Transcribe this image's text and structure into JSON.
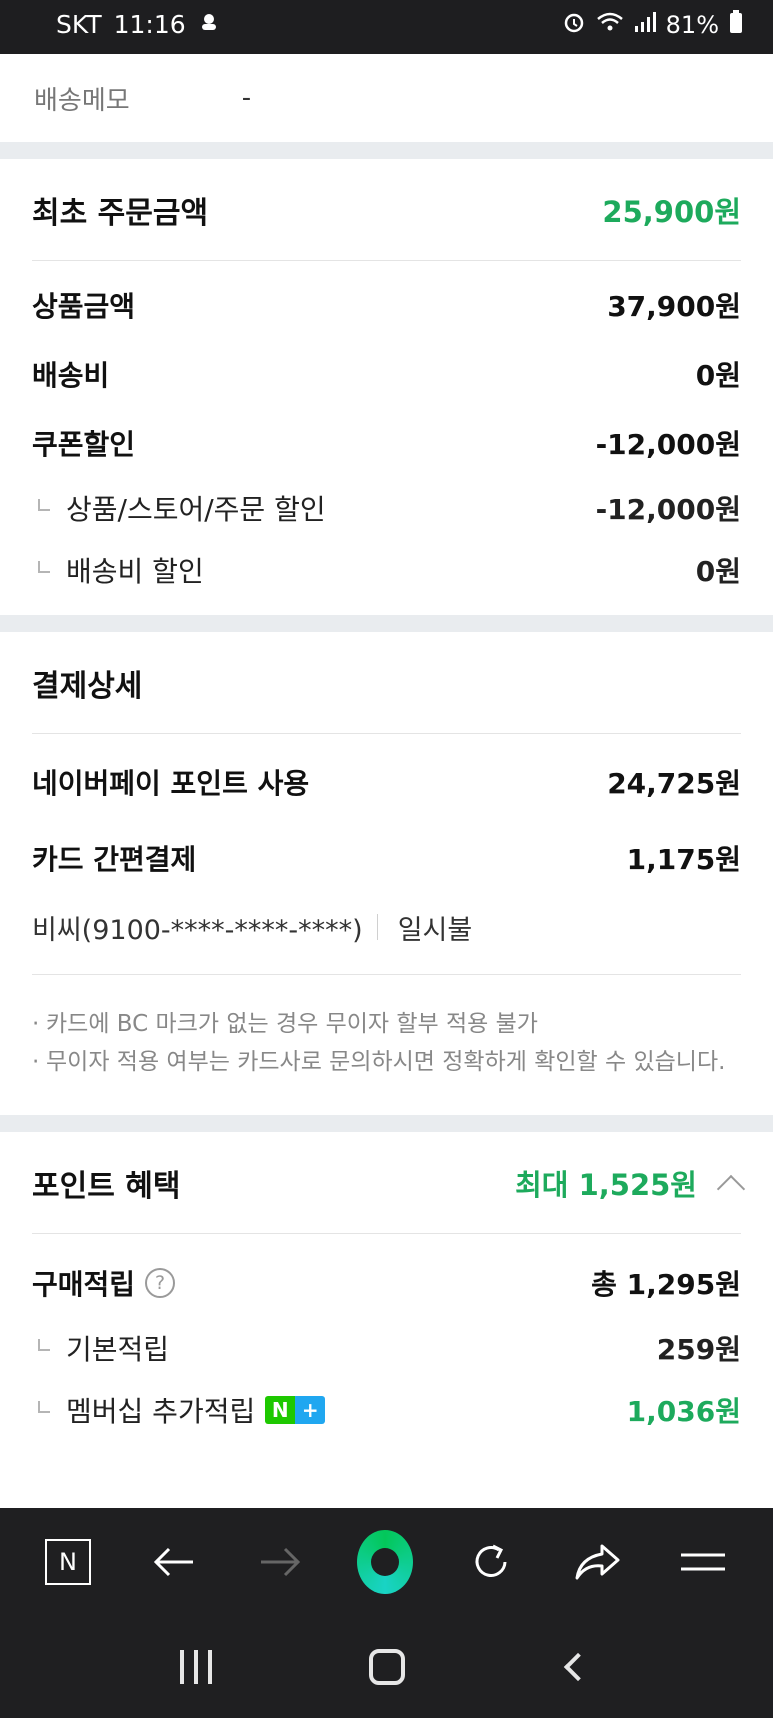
{
  "status_bar": {
    "carrier": "SKT",
    "time": "11:16",
    "battery": "81%"
  },
  "memo": {
    "label": "배송메모",
    "value": "-"
  },
  "order": {
    "title": "최초 주문금액",
    "total": "25,900원",
    "rows": [
      {
        "label": "상품금액",
        "amount": "37,900원"
      },
      {
        "label": "배송비",
        "amount": "0원"
      },
      {
        "label": "쿠폰할인",
        "amount": "-12,000원"
      }
    ],
    "subrows": [
      {
        "label": "상품/스토어/주문 할인",
        "amount": "-12,000원"
      },
      {
        "label": "배송비 할인",
        "amount": "0원"
      }
    ]
  },
  "payment": {
    "title": "결제상세",
    "rows": [
      {
        "label": "네이버페이 포인트 사용",
        "amount": "24,725원"
      },
      {
        "label": "카드 간편결제",
        "amount": "1,175원"
      }
    ],
    "card": {
      "number": "비씨(9100-****-****-****)",
      "plan": "일시불"
    },
    "notes": [
      "카드에 BC 마크가 없는 경우 무이자 할부 적용 불가",
      "무이자 적용 여부는 카드사로 문의하시면 정확하게 확인할 수 있습니다."
    ]
  },
  "points": {
    "title": "포인트 혜택",
    "max": "최대 1,525원",
    "purchase_label": "구매적립",
    "purchase_help": "?",
    "purchase_total": "총 1,295원",
    "basic_label": "기본적립",
    "basic_amount": "259원",
    "member_label": "멤버십 추가적립",
    "member_amount": "1,036원",
    "badge_n": "N",
    "badge_plus": "+"
  },
  "browser": {
    "logo": "N"
  },
  "colors": {
    "accent_green": "#1daa5c",
    "separator": "#e9ecef",
    "dark_bar": "#1f1f21"
  }
}
